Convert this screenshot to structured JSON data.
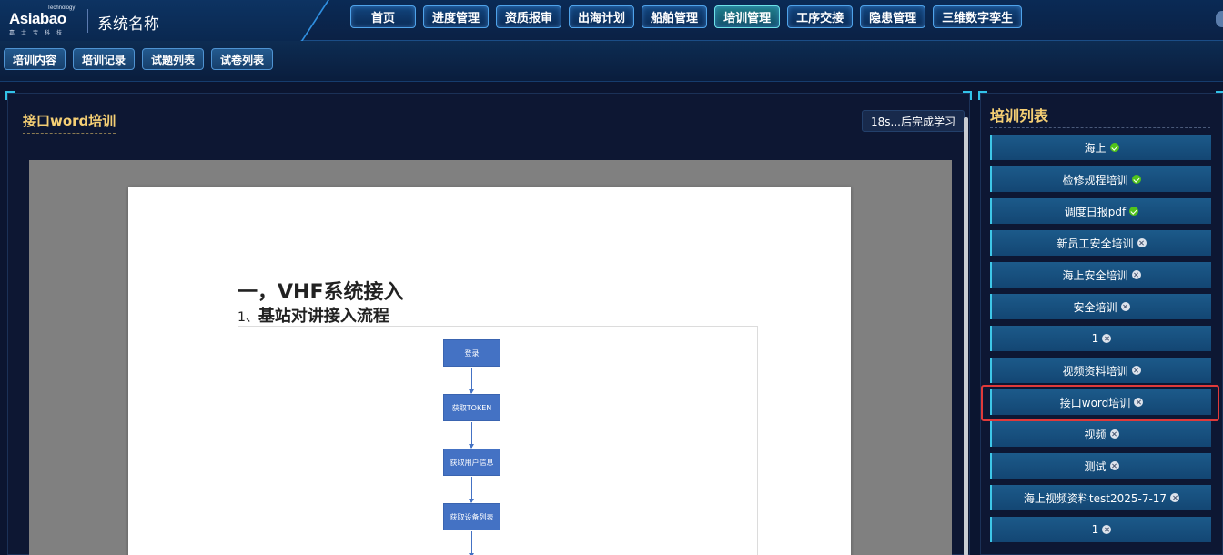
{
  "brand": {
    "logo_text": "Asiabao",
    "logo_tag": "Technology",
    "logo_cn": "嘉士宝科技",
    "system_name": "系统名称"
  },
  "main_nav": [
    {
      "label": "首页",
      "active": false
    },
    {
      "label": "进度管理",
      "active": false
    },
    {
      "label": "资质报审",
      "active": false
    },
    {
      "label": "出海计划",
      "active": false
    },
    {
      "label": "船舶管理",
      "active": false
    },
    {
      "label": "培训管理",
      "active": true
    },
    {
      "label": "工序交接",
      "active": false
    },
    {
      "label": "隐患管理",
      "active": false
    },
    {
      "label": "三维数字孪生",
      "active": false
    }
  ],
  "sub_nav": [
    "培训内容",
    "培训记录",
    "试题列表",
    "试卷列表"
  ],
  "main": {
    "title": "接口word培训",
    "timer_text": "18s...后完成学习"
  },
  "document": {
    "heading1": "一，VHF系统接入",
    "heading2_num": "1、",
    "heading2": "基站对讲接入流程",
    "flow_steps": [
      "登录",
      "获取TOKEN",
      "获取用户信息",
      "获取设备列表"
    ]
  },
  "training_list": {
    "title": "培训列表",
    "items": [
      {
        "label": "海上",
        "status": "done"
      },
      {
        "label": "检修规程培训",
        "status": "done"
      },
      {
        "label": "调度日报pdf",
        "status": "done"
      },
      {
        "label": "新员工安全培训",
        "status": "pending"
      },
      {
        "label": "海上安全培训",
        "status": "pending"
      },
      {
        "label": "安全培训",
        "status": "pending"
      },
      {
        "label": "1",
        "status": "pending"
      },
      {
        "label": "视频资料培训",
        "status": "pending"
      },
      {
        "label": "接口word培训",
        "status": "pending",
        "selected": true
      },
      {
        "label": "视频",
        "status": "pending"
      },
      {
        "label": "测试",
        "status": "pending"
      },
      {
        "label": "海上视频资料test2025-7-17",
        "status": "pending"
      },
      {
        "label": "1",
        "status": "pending"
      }
    ]
  },
  "colors": {
    "accent_gold": "#f5cf74",
    "done_green": "#52c41a",
    "selected_red": "#e03a3a",
    "flow_blue": "#4472c4"
  }
}
